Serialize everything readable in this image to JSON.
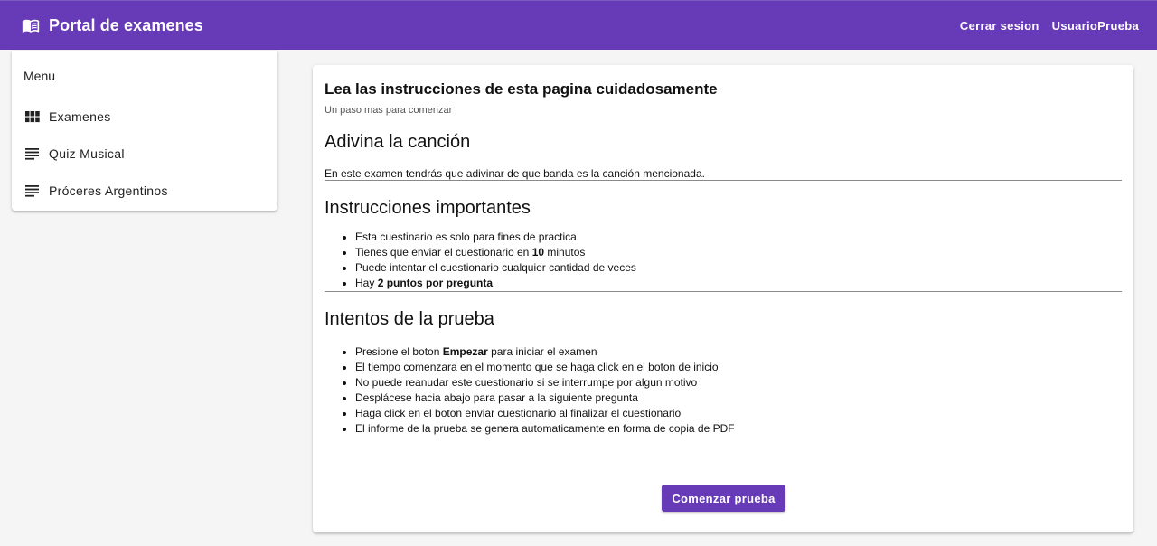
{
  "header": {
    "title": "Portal de examenes",
    "logout_label": "Cerrar sesion",
    "user_label": "UsuarioPrueba",
    "brand_color": "#673ab7"
  },
  "sidebar": {
    "heading": "Menu",
    "items": [
      {
        "label": "Examenes",
        "icon": "grid-icon"
      },
      {
        "label": "Quiz Musical",
        "icon": "notes-icon"
      },
      {
        "label": "Próceres Argentinos",
        "icon": "notes-icon"
      }
    ]
  },
  "main": {
    "title": "Lea las instrucciones de esta pagina cuidadosamente",
    "subtitle": "Un paso mas para comenzar",
    "exam_title": "Adivina la canción",
    "exam_description": "En este examen tendrás que adivinar de que banda es la canción mencionada.",
    "instructions_title": "Instrucciones importantes",
    "instructions": [
      {
        "before": "Esta cuestinario es solo para fines de practica",
        "bold": "",
        "after": ""
      },
      {
        "before": "Tienes que enviar el cuestionario en ",
        "bold": "10",
        "after": " minutos"
      },
      {
        "before": "Puede intentar el cuestionario cualquier cantidad de veces",
        "bold": "",
        "after": ""
      },
      {
        "before": "Hay ",
        "bold": "2 puntos por pregunta",
        "after": ""
      }
    ],
    "attempts_title": "Intentos de la prueba",
    "attempts": [
      {
        "before": "Presione el boton ",
        "bold": "Empezar",
        "after": " para iniciar el examen"
      },
      {
        "before": "El tiempo comenzara en el momento que se haga click en el boton de inicio",
        "bold": "",
        "after": ""
      },
      {
        "before": "No puede reanudar este cuestionario si se interrumpe por algun motivo",
        "bold": "",
        "after": ""
      },
      {
        "before": "Desplácese hacia abajo para pasar a la siguiente pregunta",
        "bold": "",
        "after": ""
      },
      {
        "before": "Haga click en el boton enviar cuestionario al finalizar el cuestionario",
        "bold": "",
        "after": ""
      },
      {
        "before": "El informe de la prueba se genera automaticamente en forma de copia de PDF",
        "bold": "",
        "after": ""
      }
    ],
    "start_button_label": "Comenzar prueba"
  }
}
